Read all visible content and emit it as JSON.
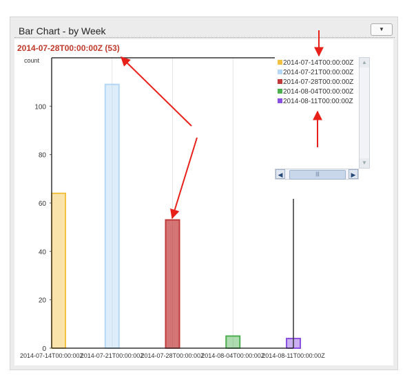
{
  "panel": {
    "title": "Bar Chart - by Week",
    "menu_icon": "chevron-down-icon"
  },
  "chart_data": {
    "type": "bar",
    "categories": [
      "2014-07-14T00:00:00Z",
      "2014-07-21T00:00:00Z",
      "2014-07-28T00:00:00Z",
      "2014-08-04T00:00:00Z",
      "2014-08-11T00:00:00Z"
    ],
    "values": [
      64,
      109,
      53,
      5,
      4
    ],
    "colors": [
      "#f2c142",
      "#b3d7f5",
      "#c0393b",
      "#4caf50",
      "#8a4fe0"
    ],
    "selected_label": "2014-07-28T00:00:00Z (53)",
    "ylabel": "count",
    "ylim": [
      0,
      120
    ],
    "yticks": [
      0,
      20,
      40,
      60,
      80,
      100
    ],
    "grid": true,
    "legend_position": "top-right"
  },
  "annotation_color": "#e8201a"
}
